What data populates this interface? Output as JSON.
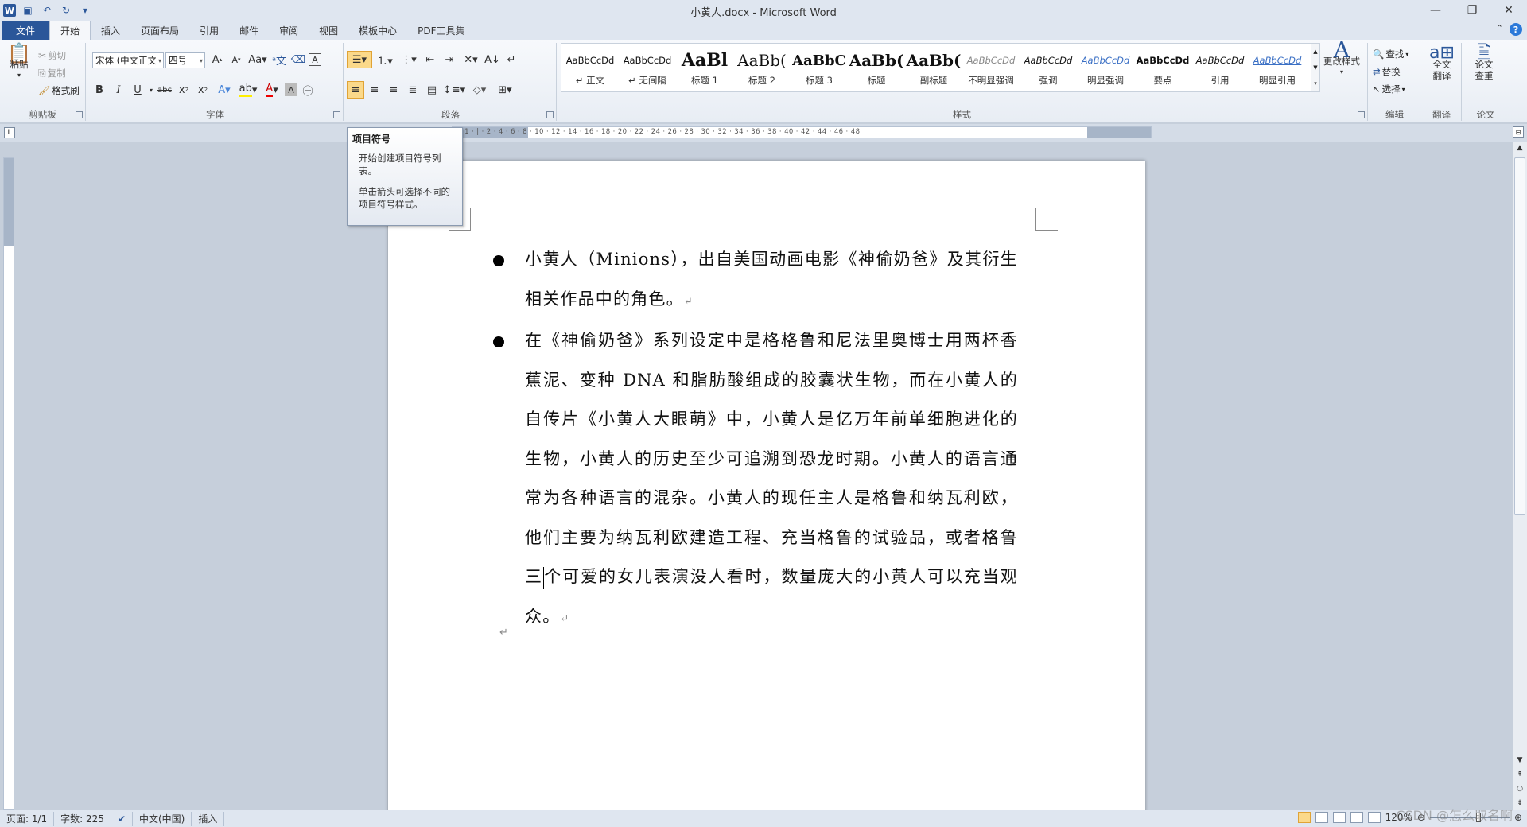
{
  "window": {
    "title": "小黄人.docx - Microsoft Word",
    "minimize": "—",
    "restore": "❐",
    "close": "✕"
  },
  "tabs": [
    {
      "label": "文件"
    },
    {
      "label": "开始"
    },
    {
      "label": "插入"
    },
    {
      "label": "页面布局"
    },
    {
      "label": "引用"
    },
    {
      "label": "邮件"
    },
    {
      "label": "审阅"
    },
    {
      "label": "视图"
    },
    {
      "label": "模板中心"
    },
    {
      "label": "PDF工具集"
    }
  ],
  "ribbon": {
    "clipboard": {
      "label": "剪贴板",
      "paste": "粘贴",
      "cut": "剪切",
      "copy": "复制",
      "format_painter": "格式刷"
    },
    "font": {
      "label": "字体",
      "font_name": "宋体 (中文正文)",
      "font_size": "四号"
    },
    "paragraph": {
      "label": "段落"
    },
    "styles": {
      "label": "样式",
      "items": [
        {
          "sample": "AaBbCcDd",
          "name": "↵ 正文"
        },
        {
          "sample": "AaBbCcDd",
          "name": "↵ 无间隔"
        },
        {
          "sample": "AaBl",
          "name": "标题 1"
        },
        {
          "sample": "AaBb(",
          "name": "标题 2"
        },
        {
          "sample": "AaBbC",
          "name": "标题 3"
        },
        {
          "sample": "AaBb(",
          "name": "标题"
        },
        {
          "sample": "AaBb(",
          "name": "副标题"
        },
        {
          "sample": "AaBbCcDd",
          "name": "不明显强调"
        },
        {
          "sample": "AaBbCcDd",
          "name": "强调"
        },
        {
          "sample": "AaBbCcDd",
          "name": "明显强调"
        },
        {
          "sample": "AaBbCcDd",
          "name": "要点"
        },
        {
          "sample": "AaBbCcDd",
          "name": "引用"
        },
        {
          "sample": "AaBbCcDd",
          "name": "明显引用"
        }
      ],
      "change_styles": "更改样式"
    },
    "editing": {
      "label": "编辑",
      "find": "查找",
      "replace": "替换",
      "select": "选择"
    },
    "translate": {
      "label": "翻译",
      "full_translate": "全文翻译"
    },
    "paper": {
      "label": "论文",
      "check": "论文查重"
    }
  },
  "ruler": {
    "ticks": "2 · 1 · | · 2 · 4 · 6 · 8 · 10 · 12 · 14 · 16 · 18 · 20 · 22 · 24 · 26 · 28 · 30 · 32 · 34 · 36 · 38 · 40 · 42 · 44 · 46 · 48"
  },
  "tooltip": {
    "title": "项目符号",
    "line1": "开始创建项目符号列表。",
    "line2": "单击箭头可选择不同的项目符号样式。"
  },
  "document": {
    "bullets": [
      "小黄人（Minions），出自美国动画电影《神偷奶爸》及其衍生相关作品中的角色。",
      "在《神偷奶爸》系列设定中是格格鲁和尼法里奥博士用两杯香蕉泥、变种 DNA 和脂肪酸组成的胶囊状生物，而在小黄人的自传片《小黄人大眼萌》中，小黄人是亿万年前单细胞进化的生物，小黄人的历史至少可追溯到恐龙时期。小黄人的语言通常为各种语言的混杂。小黄人的现任主人是格鲁和纳瓦利欧，他们主要为纳瓦利欧建造工程、充当格鲁的试验品，或者格鲁三"
    ],
    "last_line": "个可爱的女儿表演没人看时，数量庞大的小黄人可以充当观众。",
    "para_mark": "↵"
  },
  "statusbar": {
    "page": "页面: 1/1",
    "words": "字数: 225",
    "language": "中文(中国)",
    "mode": "插入",
    "zoom": "120%",
    "watermark": "CSDN @怎么取名啊"
  }
}
